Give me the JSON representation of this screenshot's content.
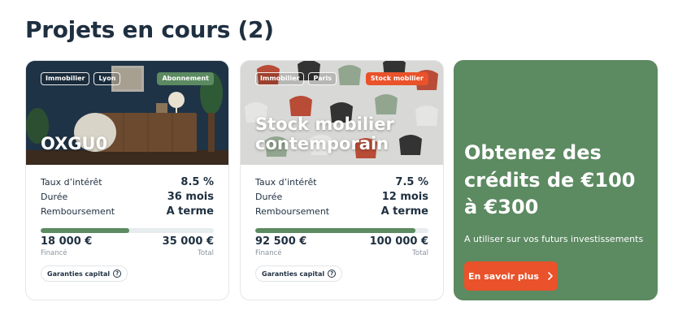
{
  "section_title": "Projets en cours (2)",
  "projects": [
    {
      "tags": [
        "Immobilier",
        "Lyon"
      ],
      "badge": "Abonnement",
      "name": "OXGU0",
      "rate_label": "Taux d’intérêt",
      "rate": "8.5 %",
      "duration_label": "Durée",
      "duration": "36 mois",
      "repayment_label": "Remboursement",
      "repayment": "A terme",
      "funded": "18 000 €",
      "total": "35 000 €",
      "funded_label": "Financé",
      "total_label": "Total",
      "progress_fraction": 0.514,
      "guarantee": "Garanties capital"
    },
    {
      "tags": [
        "Immobilier",
        "Paris"
      ],
      "badge": "Stock mobilier",
      "name_line1": "Stock mobilier",
      "name_line2": "contemporain",
      "rate_label": "Taux d’intérêt",
      "rate": "7.5 %",
      "duration_label": "Durée",
      "duration": "12 mois",
      "repayment_label": "Remboursement",
      "repayment": "A terme",
      "funded": "92 500 €",
      "total": "100 000 €",
      "funded_label": "Financé",
      "total_label": "Total",
      "progress_fraction": 0.925,
      "guarantee": "Garanties capital"
    }
  ],
  "promo": {
    "title": "Obtenez des crédits de €100 à €300",
    "subtitle": "A utiliser sur vos futurs investissements",
    "button": "En savoir plus",
    "button_icon": "chevron-right-icon"
  },
  "colors": {
    "brand_green": "#5c8a61",
    "accent_orange": "#e9522a",
    "text_dark": "#1e2f40"
  }
}
